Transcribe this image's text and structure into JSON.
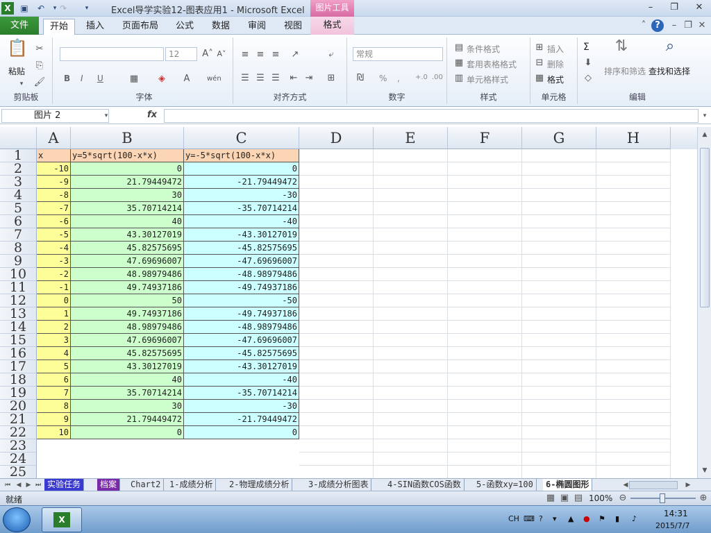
{
  "window": {
    "title": "Excel导学实验12-图表应用1  -  Microsoft Excel",
    "context_tab": "图片工具",
    "min": "–",
    "restore": "❐",
    "close": "✕"
  },
  "tabs": {
    "file": "文件",
    "items": [
      "开始",
      "插入",
      "页面布局",
      "公式",
      "数据",
      "审阅",
      "视图"
    ],
    "format": "格式"
  },
  "ribbon": {
    "clipboard": {
      "label": "剪贴板",
      "paste": "粘贴"
    },
    "font": {
      "label": "字体",
      "size": "12",
      "bold": "B",
      "italic": "I",
      "underline": "U"
    },
    "alignment": {
      "label": "对齐方式"
    },
    "number": {
      "label": "数字",
      "format": "常规",
      "percent": "%",
      "comma": ",",
      "inc": "+.0",
      "dec": ".00"
    },
    "styles": {
      "label": "样式",
      "cond": "条件格式",
      "table": "套用表格格式",
      "cell": "单元格样式"
    },
    "cells": {
      "label": "单元格",
      "insert": "插入",
      "delete": "删除",
      "format": "格式"
    },
    "editing": {
      "label": "编辑",
      "sort": "排序和筛选",
      "find": "查找和选择",
      "sum": "Σ"
    }
  },
  "formula_bar": {
    "name_box": "图片 2",
    "fx": "fx",
    "formula": ""
  },
  "grid": {
    "columns": [
      "A",
      "B",
      "C",
      "D",
      "E",
      "F",
      "G",
      "H"
    ],
    "headers": [
      "x",
      "y=5*sqrt(100-x*x)",
      "y=-5*sqrt(100-x*x)"
    ],
    "rows": [
      [
        "-10",
        "0",
        "0"
      ],
      [
        "-9",
        "21.79449472",
        "-21.79449472"
      ],
      [
        "-8",
        "30",
        "-30"
      ],
      [
        "-7",
        "35.70714214",
        "-35.70714214"
      ],
      [
        "-6",
        "40",
        "-40"
      ],
      [
        "-5",
        "43.30127019",
        "-43.30127019"
      ],
      [
        "-4",
        "45.82575695",
        "-45.82575695"
      ],
      [
        "-3",
        "47.69696007",
        "-47.69696007"
      ],
      [
        "-2",
        "48.98979486",
        "-48.98979486"
      ],
      [
        "-1",
        "49.74937186",
        "-49.74937186"
      ],
      [
        "0",
        "50",
        "-50"
      ],
      [
        "1",
        "49.74937186",
        "-49.74937186"
      ],
      [
        "2",
        "48.98979486",
        "-48.98979486"
      ],
      [
        "3",
        "47.69696007",
        "-47.69696007"
      ],
      [
        "4",
        "45.82575695",
        "-45.82575695"
      ],
      [
        "5",
        "43.30127019",
        "-43.30127019"
      ],
      [
        "6",
        "40",
        "-40"
      ],
      [
        "7",
        "35.70714214",
        "-35.70714214"
      ],
      [
        "8",
        "30",
        "-30"
      ],
      [
        "9",
        "21.79449472",
        "-21.79449472"
      ],
      [
        "10",
        "0",
        "0"
      ]
    ],
    "row_numbers": [
      "1",
      "2",
      "3",
      "4",
      "5",
      "6",
      "7",
      "8",
      "9",
      "10",
      "11",
      "12",
      "13",
      "14",
      "15",
      "16",
      "17",
      "18",
      "19",
      "20",
      "21",
      "22",
      "23",
      "24",
      "25"
    ]
  },
  "sheets": [
    "实验任务",
    "档案",
    "Chart2",
    "1-成绩分析",
    "2-物理成绩分析",
    "3-成绩分析图表",
    "4-SIN函数COS函数",
    "5-函数xy=100",
    "6-椭圆图形"
  ],
  "status": {
    "mode": "就绪",
    "zoom": "100%"
  },
  "taskbar": {
    "lang": "CH",
    "time": "14:31",
    "date": "2015/7/7"
  }
}
